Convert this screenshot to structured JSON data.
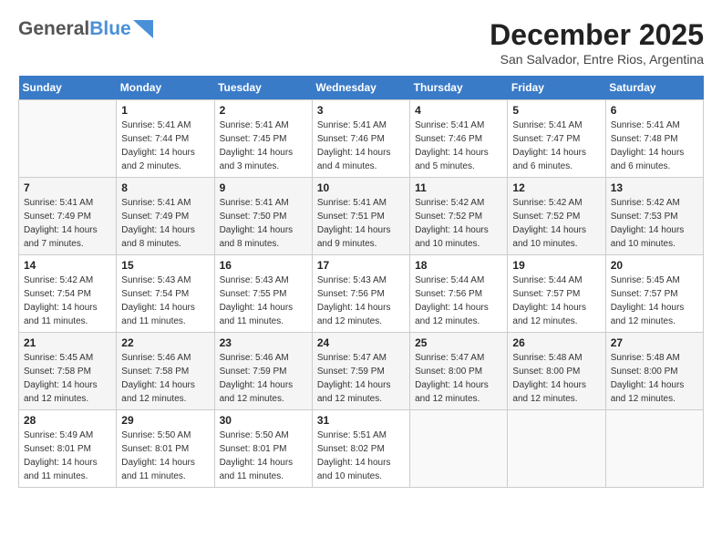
{
  "header": {
    "logo_general": "General",
    "logo_blue": "Blue",
    "month_title": "December 2025",
    "location": "San Salvador, Entre Rios, Argentina"
  },
  "days_of_week": [
    "Sunday",
    "Monday",
    "Tuesday",
    "Wednesday",
    "Thursday",
    "Friday",
    "Saturday"
  ],
  "weeks": [
    [
      {
        "day": "",
        "info": ""
      },
      {
        "day": "1",
        "info": "Sunrise: 5:41 AM\nSunset: 7:44 PM\nDaylight: 14 hours\nand 2 minutes."
      },
      {
        "day": "2",
        "info": "Sunrise: 5:41 AM\nSunset: 7:45 PM\nDaylight: 14 hours\nand 3 minutes."
      },
      {
        "day": "3",
        "info": "Sunrise: 5:41 AM\nSunset: 7:46 PM\nDaylight: 14 hours\nand 4 minutes."
      },
      {
        "day": "4",
        "info": "Sunrise: 5:41 AM\nSunset: 7:46 PM\nDaylight: 14 hours\nand 5 minutes."
      },
      {
        "day": "5",
        "info": "Sunrise: 5:41 AM\nSunset: 7:47 PM\nDaylight: 14 hours\nand 6 minutes."
      },
      {
        "day": "6",
        "info": "Sunrise: 5:41 AM\nSunset: 7:48 PM\nDaylight: 14 hours\nand 6 minutes."
      }
    ],
    [
      {
        "day": "7",
        "info": "Sunrise: 5:41 AM\nSunset: 7:49 PM\nDaylight: 14 hours\nand 7 minutes."
      },
      {
        "day": "8",
        "info": "Sunrise: 5:41 AM\nSunset: 7:49 PM\nDaylight: 14 hours\nand 8 minutes."
      },
      {
        "day": "9",
        "info": "Sunrise: 5:41 AM\nSunset: 7:50 PM\nDaylight: 14 hours\nand 8 minutes."
      },
      {
        "day": "10",
        "info": "Sunrise: 5:41 AM\nSunset: 7:51 PM\nDaylight: 14 hours\nand 9 minutes."
      },
      {
        "day": "11",
        "info": "Sunrise: 5:42 AM\nSunset: 7:52 PM\nDaylight: 14 hours\nand 10 minutes."
      },
      {
        "day": "12",
        "info": "Sunrise: 5:42 AM\nSunset: 7:52 PM\nDaylight: 14 hours\nand 10 minutes."
      },
      {
        "day": "13",
        "info": "Sunrise: 5:42 AM\nSunset: 7:53 PM\nDaylight: 14 hours\nand 10 minutes."
      }
    ],
    [
      {
        "day": "14",
        "info": "Sunrise: 5:42 AM\nSunset: 7:54 PM\nDaylight: 14 hours\nand 11 minutes."
      },
      {
        "day": "15",
        "info": "Sunrise: 5:43 AM\nSunset: 7:54 PM\nDaylight: 14 hours\nand 11 minutes."
      },
      {
        "day": "16",
        "info": "Sunrise: 5:43 AM\nSunset: 7:55 PM\nDaylight: 14 hours\nand 11 minutes."
      },
      {
        "day": "17",
        "info": "Sunrise: 5:43 AM\nSunset: 7:56 PM\nDaylight: 14 hours\nand 12 minutes."
      },
      {
        "day": "18",
        "info": "Sunrise: 5:44 AM\nSunset: 7:56 PM\nDaylight: 14 hours\nand 12 minutes."
      },
      {
        "day": "19",
        "info": "Sunrise: 5:44 AM\nSunset: 7:57 PM\nDaylight: 14 hours\nand 12 minutes."
      },
      {
        "day": "20",
        "info": "Sunrise: 5:45 AM\nSunset: 7:57 PM\nDaylight: 14 hours\nand 12 minutes."
      }
    ],
    [
      {
        "day": "21",
        "info": "Sunrise: 5:45 AM\nSunset: 7:58 PM\nDaylight: 14 hours\nand 12 minutes."
      },
      {
        "day": "22",
        "info": "Sunrise: 5:46 AM\nSunset: 7:58 PM\nDaylight: 14 hours\nand 12 minutes."
      },
      {
        "day": "23",
        "info": "Sunrise: 5:46 AM\nSunset: 7:59 PM\nDaylight: 14 hours\nand 12 minutes."
      },
      {
        "day": "24",
        "info": "Sunrise: 5:47 AM\nSunset: 7:59 PM\nDaylight: 14 hours\nand 12 minutes."
      },
      {
        "day": "25",
        "info": "Sunrise: 5:47 AM\nSunset: 8:00 PM\nDaylight: 14 hours\nand 12 minutes."
      },
      {
        "day": "26",
        "info": "Sunrise: 5:48 AM\nSunset: 8:00 PM\nDaylight: 14 hours\nand 12 minutes."
      },
      {
        "day": "27",
        "info": "Sunrise: 5:48 AM\nSunset: 8:00 PM\nDaylight: 14 hours\nand 12 minutes."
      }
    ],
    [
      {
        "day": "28",
        "info": "Sunrise: 5:49 AM\nSunset: 8:01 PM\nDaylight: 14 hours\nand 11 minutes."
      },
      {
        "day": "29",
        "info": "Sunrise: 5:50 AM\nSunset: 8:01 PM\nDaylight: 14 hours\nand 11 minutes."
      },
      {
        "day": "30",
        "info": "Sunrise: 5:50 AM\nSunset: 8:01 PM\nDaylight: 14 hours\nand 11 minutes."
      },
      {
        "day": "31",
        "info": "Sunrise: 5:51 AM\nSunset: 8:02 PM\nDaylight: 14 hours\nand 10 minutes."
      },
      {
        "day": "",
        "info": ""
      },
      {
        "day": "",
        "info": ""
      },
      {
        "day": "",
        "info": ""
      }
    ]
  ]
}
